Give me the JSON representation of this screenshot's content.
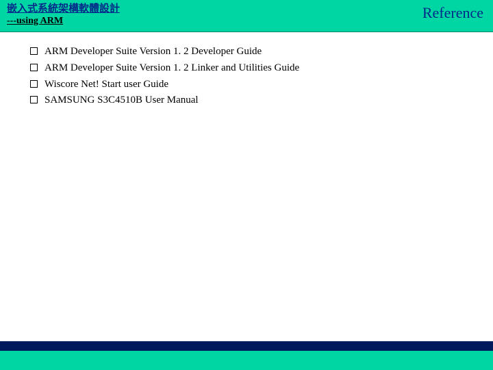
{
  "header": {
    "title_main": "嵌入式系統架構軟體設計",
    "title_sub": "---using ARM",
    "right_label": "Reference"
  },
  "bullets": {
    "b0": "ARM Developer Suite Version 1. 2 Developer Guide",
    "b1": "ARM Developer Suite Version 1. 2 Linker and Utilities Guide",
    "b2": "Wiscore Net! Start user Guide",
    "b3": "SAMSUNG S3C4510B User Manual"
  }
}
